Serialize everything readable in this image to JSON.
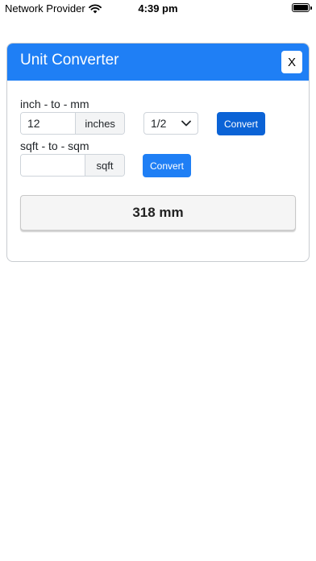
{
  "status_bar": {
    "carrier": "Network Provider",
    "time": "4:39 pm"
  },
  "modal": {
    "title": "Unit Converter",
    "close_label": "X"
  },
  "inch_converter": {
    "label": "inch - to - mm",
    "value": "12",
    "unit": "inches",
    "fraction_selected": "1/2",
    "button_label": "Convert"
  },
  "sqft_converter": {
    "label": "sqft - to - sqm",
    "value": "",
    "unit": "sqft",
    "button_label": "Convert"
  },
  "result": {
    "text": "318 mm"
  },
  "colors": {
    "header_blue": "#1f7ff5",
    "button_dark_blue": "#0b63d6"
  }
}
